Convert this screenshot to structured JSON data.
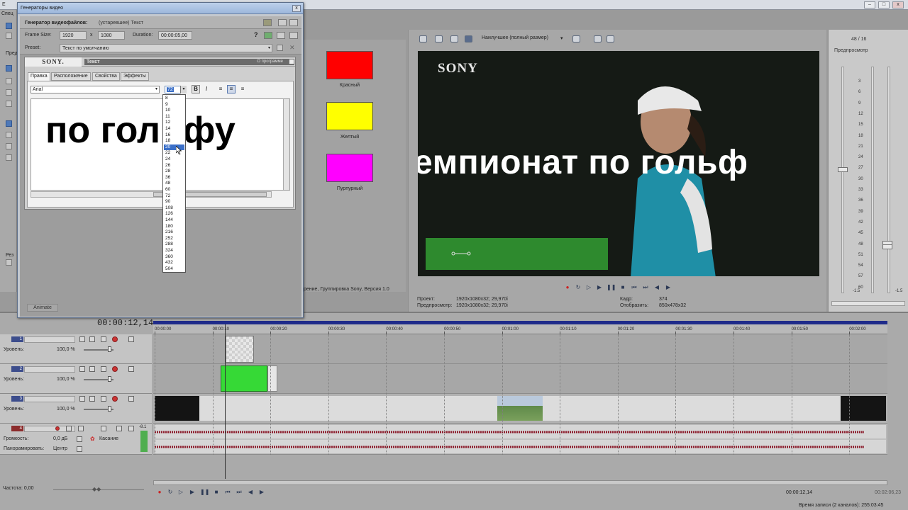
{
  "app": {
    "menu_fragment": "Е",
    "left_fragment": "Спец",
    "left_fragment2": "Рез",
    "left_fragment3": "Пред"
  },
  "dialog": {
    "title": "Генераторы видео",
    "close_label": "x",
    "generator_label": "Генератор видеофайлов:",
    "generator_value": "(устаревшее) Текст",
    "frame_size_label": "Frame Size:",
    "frame_width": "1920",
    "frame_x": "x",
    "frame_height": "1080",
    "duration_label": "Duration:",
    "duration_value": "00:00:05,00",
    "preset_label": "Preset:",
    "preset_value": "Текст по умолчанию",
    "panel_brand": "SONY.",
    "panel_type": "Текст",
    "panel_about": "О программе",
    "tabs": [
      {
        "label": "Правка"
      },
      {
        "label": "Расположение"
      },
      {
        "label": "Свойства"
      },
      {
        "label": "Эффекты"
      }
    ],
    "font_value": "Arial",
    "size_value": "72",
    "bold_label": "B",
    "italic_label": "I",
    "edit_text": "по гольфу",
    "animate_label": "Animate",
    "size_options": [
      "8",
      "9",
      "10",
      "11",
      "12",
      "14",
      "16",
      "18",
      "20",
      "22",
      "24",
      "26",
      "28",
      "36",
      "48",
      "60",
      "72",
      "90",
      "108",
      "126",
      "144",
      "180",
      "216",
      "252",
      "288",
      "324",
      "360",
      "432",
      "504"
    ],
    "size_highlight": "20"
  },
  "media": {
    "swatches": [
      {
        "label": "Красный",
        "color": "#ff0000"
      },
      {
        "label": "Желтый",
        "color": "#ffff00"
      },
      {
        "label": "Пурпурный",
        "color": "#ff00ff"
      }
    ],
    "status": "рение, Группировка Sony, Версия 1.0"
  },
  "preview": {
    "quality": "Наилучшее (полный размер)",
    "video_brand": "SONY",
    "video_title": "емпионат по гольф",
    "project_label": "Проект:",
    "project_value": "1920x1080x32; 29,970i",
    "preview_label": "Предпросмотр:",
    "preview_value": "1920x1080x32; 29,970i",
    "frame_label": "Кадр:",
    "frame_value": "374",
    "display_label": "Отобразить:",
    "display_value": "850x478x32"
  },
  "meter": {
    "rate": "48 / 16",
    "label": "Предпросмотр",
    "scale": [
      "3",
      "6",
      "9",
      "12",
      "15",
      "18",
      "21",
      "24",
      "27",
      "30",
      "33",
      "36",
      "39",
      "42",
      "45",
      "48",
      "51",
      "54",
      "57",
      "60",
      "-1.5",
      "-1.5"
    ]
  },
  "timeline": {
    "timecode": "00:00:12,14",
    "ruler": [
      "00:00:00",
      "00:00:10",
      "00:00:20",
      "00:00:30",
      "00:00:40",
      "00:00:50",
      "00:01:00",
      "00:01:10",
      "00:01:20",
      "00:01:30",
      "00:01:40",
      "00:01:50",
      "00:02:00"
    ],
    "tracks": [
      {
        "num": "1",
        "level_label": "Уровень:",
        "level_value": "100,0 %"
      },
      {
        "num": "2",
        "level_label": "Уровень:",
        "level_value": "100,0 %"
      },
      {
        "num": "3",
        "level_label": "Уровень:",
        "level_value": "100,0 %"
      }
    ],
    "audio": {
      "num": "4",
      "volume_label": "Громкость:",
      "volume_value": "0,0 дБ",
      "touch_label": "Касание",
      "pan_label": "Панорамировать:",
      "pan_value": "Центр",
      "peak": "-8.1"
    },
    "rate_label": "Частота: 0,00",
    "status_timecode": "00:00:12,14",
    "status_timecode2": "00:02:06,23",
    "record_time": "Время записи (2 каналов): 255:03:45"
  }
}
